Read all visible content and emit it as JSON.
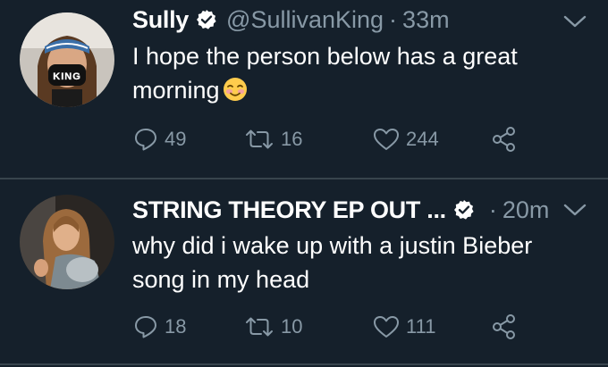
{
  "tweets": [
    {
      "display_name": "Sully",
      "handle": "@SullivanKing",
      "separator": "·",
      "time": "33m",
      "text": "I hope the person below has a great morning",
      "replies": "49",
      "retweets": "16",
      "likes": "244",
      "avatar_mask_text": "KING"
    },
    {
      "display_name": "STRING THEORY EP OUT ...",
      "handle": "",
      "separator": "·",
      "time": "20m",
      "text": "why did i wake up with a justin Bieber song in my head",
      "replies": "18",
      "retweets": "10",
      "likes": "111"
    }
  ],
  "colors": {
    "background": "#15202b",
    "secondary_text": "#8899a6",
    "divider": "#38444d",
    "verified_badge": "#ffffff"
  },
  "icons": [
    "verified-badge-icon",
    "chevron-down-icon",
    "reply-icon",
    "retweet-icon",
    "like-icon",
    "share-icon",
    "smiling-face-emoji"
  ]
}
